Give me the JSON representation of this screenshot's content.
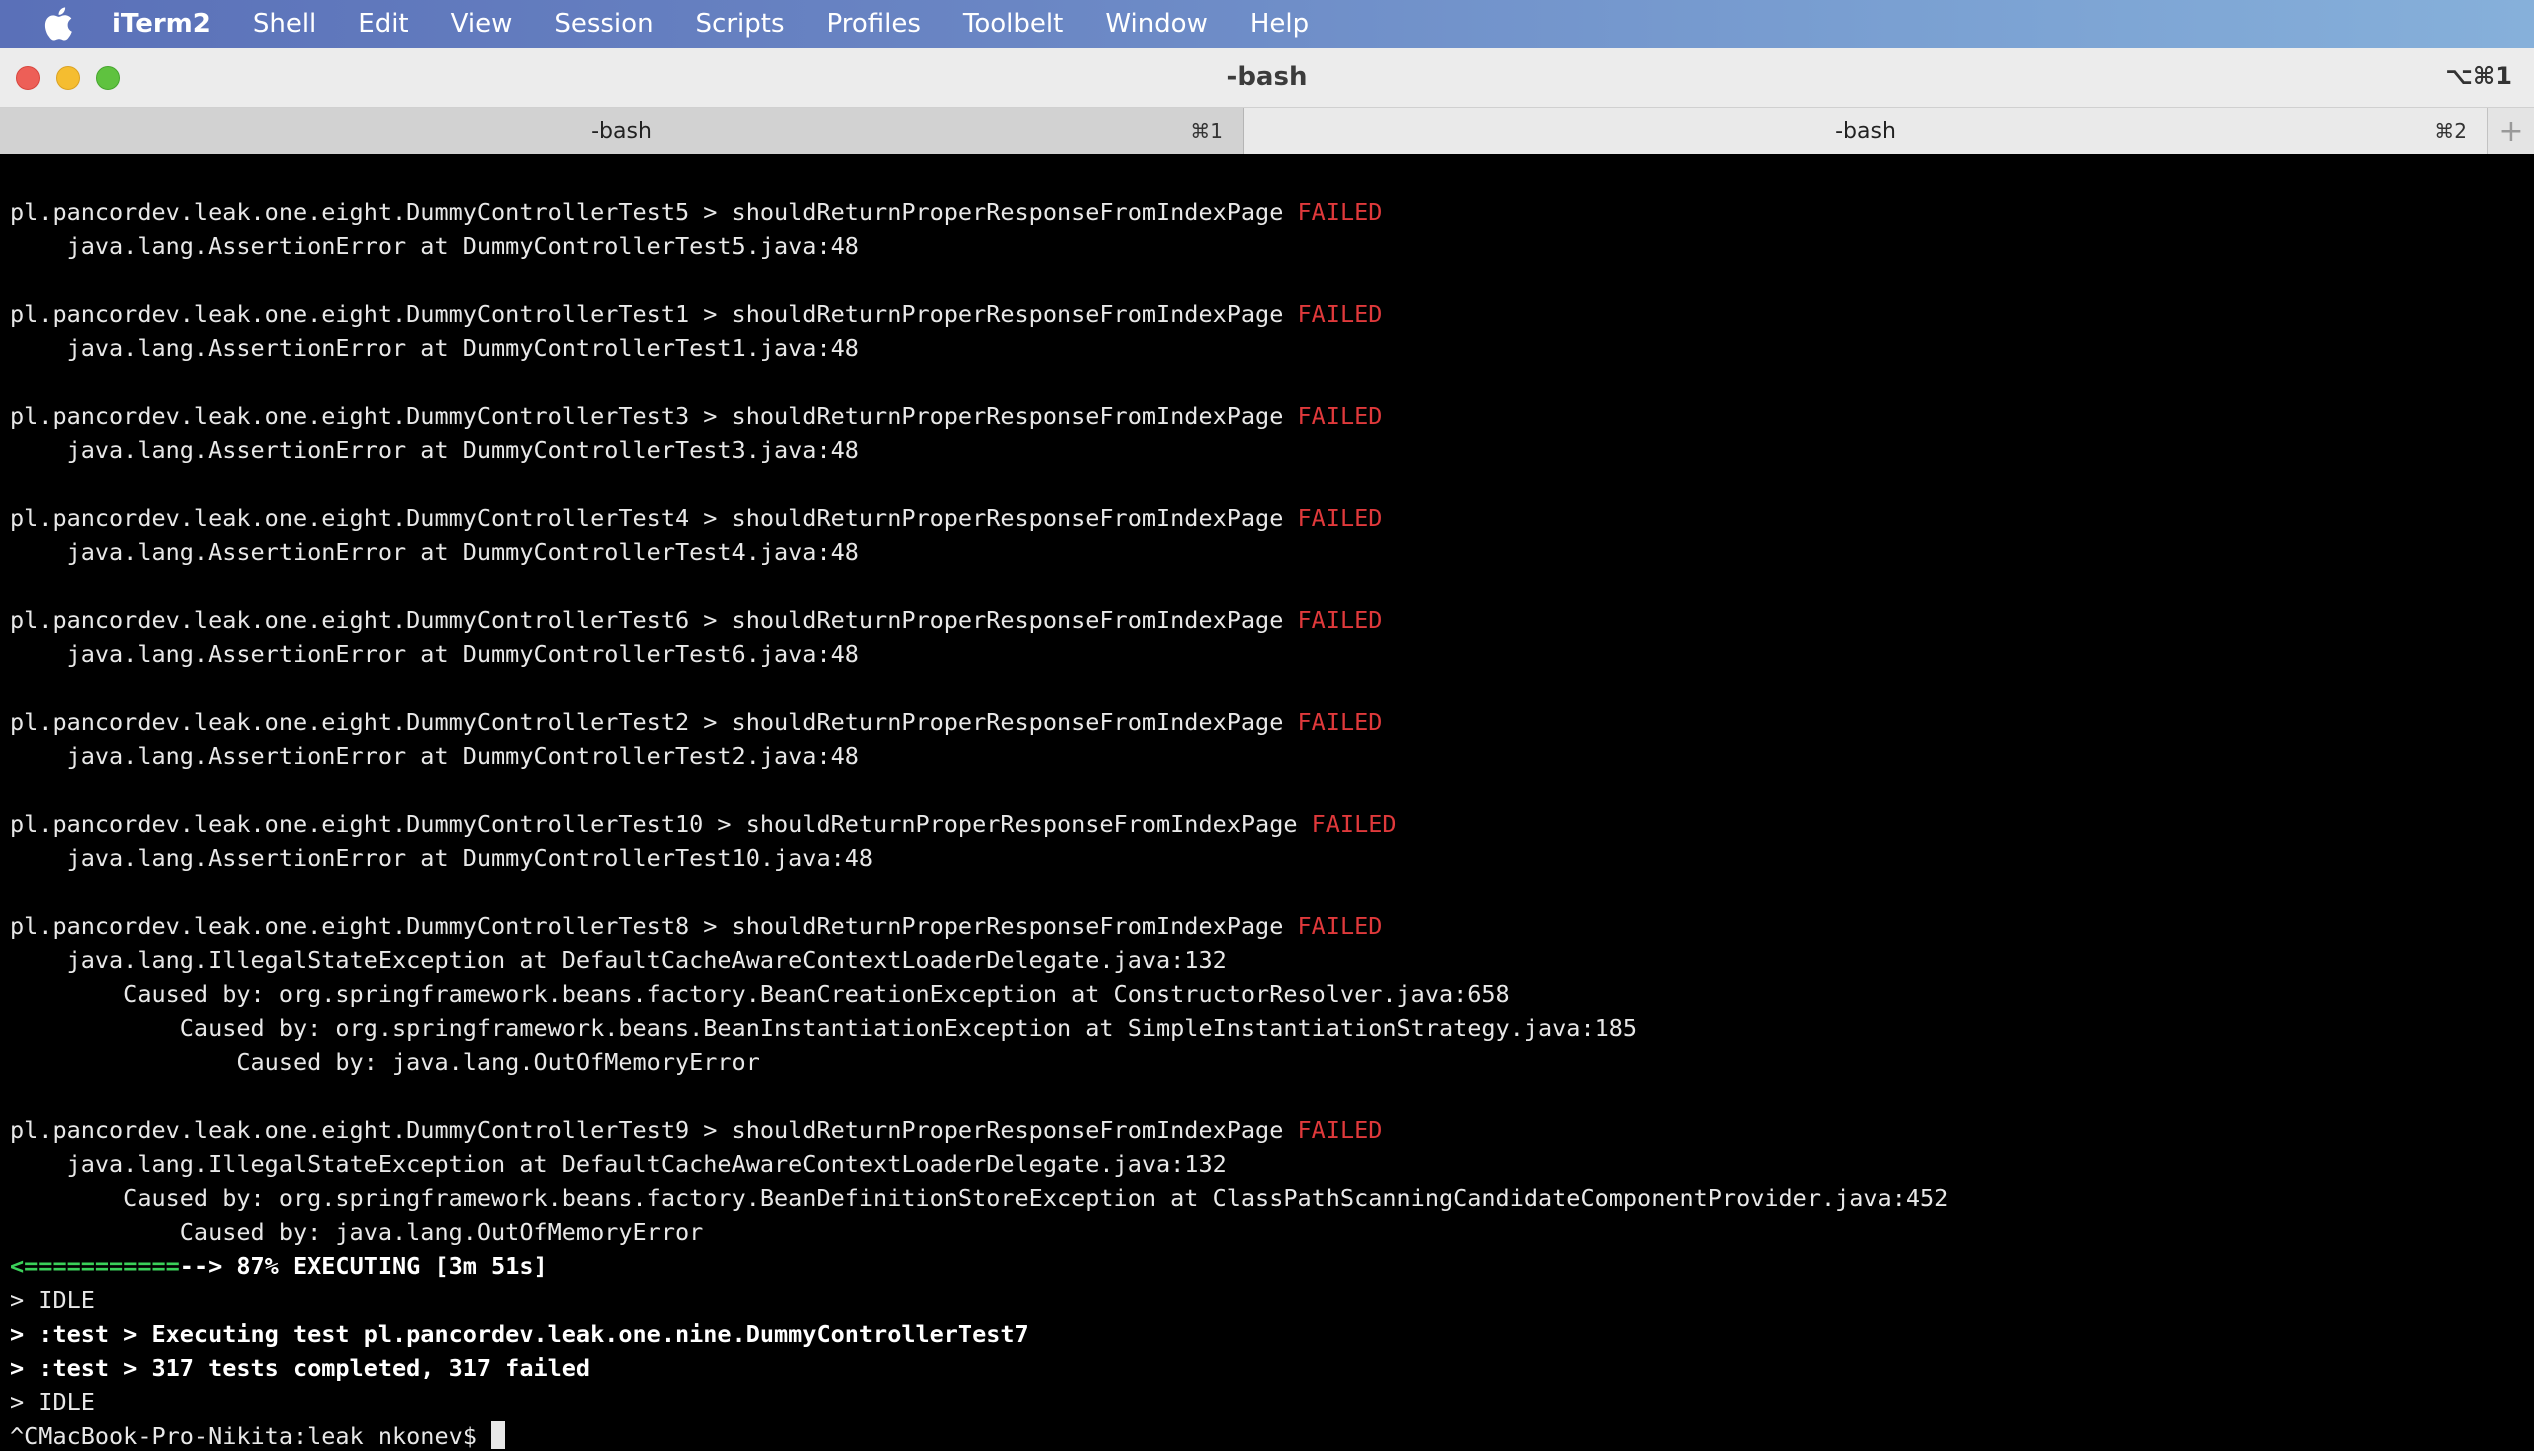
{
  "menubar": {
    "apple": "apple-icon",
    "items": [
      "iTerm2",
      "Shell",
      "Edit",
      "View",
      "Session",
      "Scripts",
      "Profiles",
      "Toolbelt",
      "Window",
      "Help"
    ]
  },
  "window": {
    "title": "-bash",
    "shortcut": "⌥⌘1"
  },
  "tabs": [
    {
      "label": "-bash",
      "shortcut": "⌘1"
    },
    {
      "label": "-bash",
      "shortcut": "⌘2"
    }
  ],
  "tab_add": "+",
  "terminal": {
    "failed_word": "FAILED",
    "blocks": [
      {
        "header": "pl.pancordev.leak.one.eight.DummyControllerTest5 > shouldReturnProperResponseFromIndexPage ",
        "details": [
          "    java.lang.AssertionError at DummyControllerTest5.java:48"
        ]
      },
      {
        "header": "pl.pancordev.leak.one.eight.DummyControllerTest1 > shouldReturnProperResponseFromIndexPage ",
        "details": [
          "    java.lang.AssertionError at DummyControllerTest1.java:48"
        ]
      },
      {
        "header": "pl.pancordev.leak.one.eight.DummyControllerTest3 > shouldReturnProperResponseFromIndexPage ",
        "details": [
          "    java.lang.AssertionError at DummyControllerTest3.java:48"
        ]
      },
      {
        "header": "pl.pancordev.leak.one.eight.DummyControllerTest4 > shouldReturnProperResponseFromIndexPage ",
        "details": [
          "    java.lang.AssertionError at DummyControllerTest4.java:48"
        ]
      },
      {
        "header": "pl.pancordev.leak.one.eight.DummyControllerTest6 > shouldReturnProperResponseFromIndexPage ",
        "details": [
          "    java.lang.AssertionError at DummyControllerTest6.java:48"
        ]
      },
      {
        "header": "pl.pancordev.leak.one.eight.DummyControllerTest2 > shouldReturnProperResponseFromIndexPage ",
        "details": [
          "    java.lang.AssertionError at DummyControllerTest2.java:48"
        ]
      },
      {
        "header": "pl.pancordev.leak.one.eight.DummyControllerTest10 > shouldReturnProperResponseFromIndexPage ",
        "details": [
          "    java.lang.AssertionError at DummyControllerTest10.java:48"
        ]
      },
      {
        "header": "pl.pancordev.leak.one.eight.DummyControllerTest8 > shouldReturnProperResponseFromIndexPage ",
        "details": [
          "    java.lang.IllegalStateException at DefaultCacheAwareContextLoaderDelegate.java:132",
          "        Caused by: org.springframework.beans.factory.BeanCreationException at ConstructorResolver.java:658",
          "            Caused by: org.springframework.beans.BeanInstantiationException at SimpleInstantiationStrategy.java:185",
          "                Caused by: java.lang.OutOfMemoryError"
        ]
      },
      {
        "header": "pl.pancordev.leak.one.eight.DummyControllerTest9 > shouldReturnProperResponseFromIndexPage ",
        "details": [
          "    java.lang.IllegalStateException at DefaultCacheAwareContextLoaderDelegate.java:132",
          "        Caused by: org.springframework.beans.factory.BeanDefinitionStoreException at ClassPathScanningCandidateComponentProvider.java:452",
          "            Caused by: java.lang.OutOfMemoryError"
        ]
      }
    ],
    "progress": {
      "bar_start": "<",
      "bar_filled": "===========",
      "bar_rest": "--> ",
      "status": "87% EXECUTING [3m 51s]",
      "percent": 87
    },
    "status_lines": [
      {
        "text": "> IDLE",
        "bold": false
      },
      {
        "text": "> :test > Executing test pl.pancordev.leak.one.nine.DummyControllerTest7",
        "bold": true
      },
      {
        "text": "> :test > 317 tests completed, 317 failed",
        "bold": true
      },
      {
        "text": "> IDLE",
        "bold": false
      }
    ],
    "prompt": "^CMacBook-Pro-Nikita:leak nkonev$ "
  }
}
